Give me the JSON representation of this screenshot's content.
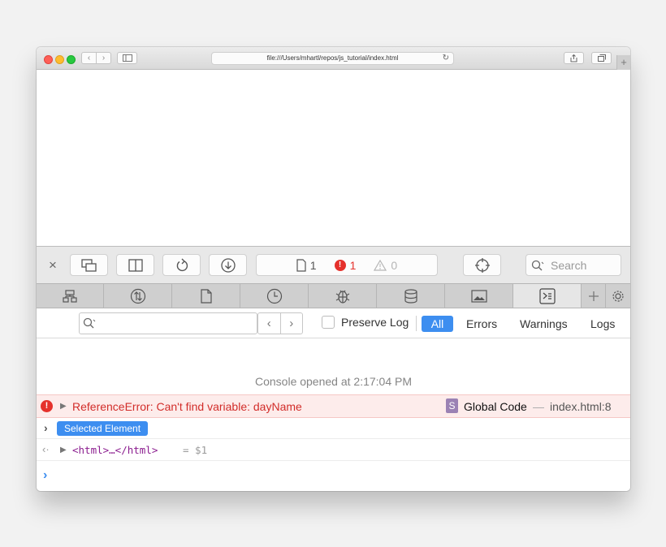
{
  "titlebar": {
    "address": "file:///Users/mhartl/repos/js_tutorial/index.html",
    "new_tab": "+"
  },
  "inspector_toolbar": {
    "close": "×",
    "resource_count": "1",
    "error_count": "1",
    "warning_count": "0",
    "search_placeholder": "Search"
  },
  "tabs": [
    {
      "name": "elements",
      "icon": "elements-icon"
    },
    {
      "name": "network",
      "icon": "network-icon"
    },
    {
      "name": "resources",
      "icon": "resources-icon"
    },
    {
      "name": "timelines",
      "icon": "timelines-icon"
    },
    {
      "name": "debugger",
      "icon": "debugger-icon"
    },
    {
      "name": "storage",
      "icon": "storage-icon"
    },
    {
      "name": "canvas",
      "icon": "canvas-icon"
    },
    {
      "name": "console",
      "icon": "console-icon",
      "active": true
    }
  ],
  "filter_bar": {
    "preserve_log_label": "Preserve Log",
    "filters": [
      "All",
      "Errors",
      "Warnings",
      "Logs"
    ],
    "active_filter": "All"
  },
  "console": {
    "opened_message": "Console opened at 2:17:04 PM",
    "error": {
      "message": "ReferenceError: Can't find variable: dayName",
      "scope_badge": "S",
      "scope": "Global Code",
      "separator": "—",
      "location": "index.html:8"
    },
    "selected_element_badge": "Selected Element",
    "result": {
      "code": "<html>…</html>",
      "assignment": "= $1"
    }
  },
  "colors": {
    "accent": "#3d8ef0",
    "error": "#e5312c",
    "error_text": "#d22d2a",
    "error_row_bg": "#fdeceb",
    "tag_color": "#8b1d8f"
  }
}
